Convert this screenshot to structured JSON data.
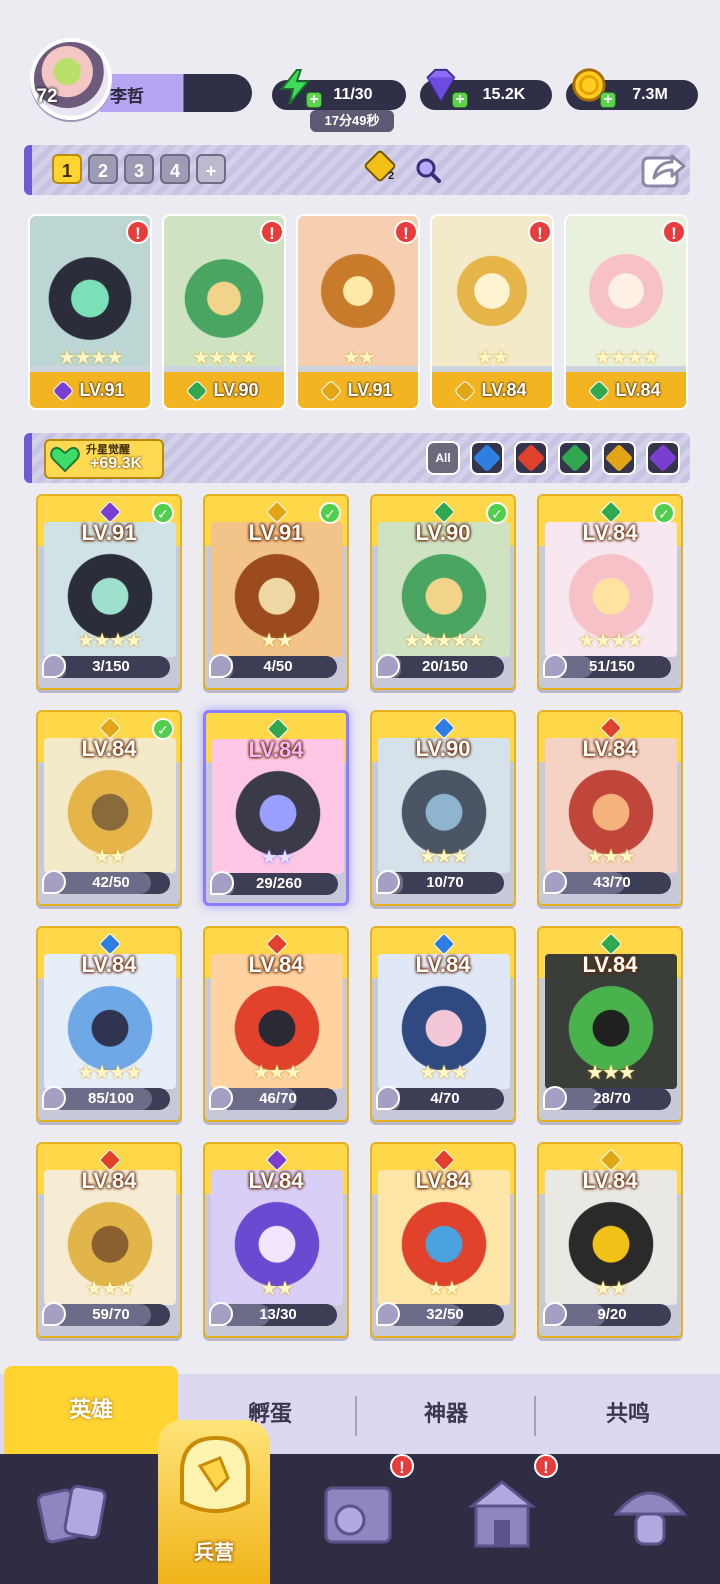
{
  "player": {
    "level": "72",
    "name": "李哲"
  },
  "resources": {
    "energy": "11/30",
    "energy_timer": "17分49秒",
    "gems": "15.2K",
    "gold": "7.3M"
  },
  "team_tabs": [
    "1",
    "2",
    "3",
    "4",
    "+"
  ],
  "team_key_count": "2",
  "team": [
    {
      "level": "LV.91",
      "element": "dark",
      "stars": "★★★★"
    },
    {
      "level": "LV.90",
      "element": "nature",
      "stars": "★★★★"
    },
    {
      "level": "LV.91",
      "element": "light",
      "stars": "★★"
    },
    {
      "level": "LV.84",
      "element": "light",
      "stars": "★★"
    },
    {
      "level": "LV.84",
      "element": "nature",
      "stars": "★★★★"
    }
  ],
  "awaken": {
    "label": "升星觉醒",
    "value": "+69.3K"
  },
  "filters": [
    "All",
    "water",
    "fire",
    "nature",
    "light",
    "dark"
  ],
  "heroes": [
    {
      "level": "LV.91",
      "element": "dark",
      "shards": "3/150",
      "progress": 0.02,
      "stars": "★★★★",
      "check": true
    },
    {
      "level": "LV.91",
      "element": "light",
      "shards": "4/50",
      "progress": 0.08,
      "stars": "★★",
      "check": true
    },
    {
      "level": "LV.90",
      "element": "nature",
      "shards": "20/150",
      "progress": 0.13,
      "stars": "★★★★★",
      "check": true
    },
    {
      "level": "LV.84",
      "element": "nature",
      "shards": "51/150",
      "progress": 0.34,
      "stars": "★★★★",
      "check": true
    },
    {
      "level": "LV.84",
      "element": "light",
      "shards": "42/50",
      "progress": 0.84,
      "stars": "★★",
      "check": true
    },
    {
      "level": "LV.84",
      "element": "nature",
      "shards": "29/260",
      "progress": 0.11,
      "stars": "★★",
      "check": false,
      "selected": true
    },
    {
      "level": "LV.90",
      "element": "water",
      "shards": "10/70",
      "progress": 0.14,
      "stars": "★★★",
      "check": false
    },
    {
      "level": "LV.84",
      "element": "fire",
      "shards": "43/70",
      "progress": 0.61,
      "stars": "★★★",
      "check": false
    },
    {
      "level": "LV.84",
      "element": "water",
      "shards": "85/100",
      "progress": 0.85,
      "stars": "★★★★",
      "check": false
    },
    {
      "level": "LV.84",
      "element": "fire",
      "shards": "46/70",
      "progress": 0.66,
      "stars": "★★★",
      "check": false
    },
    {
      "level": "LV.84",
      "element": "water",
      "shards": "4/70",
      "progress": 0.06,
      "stars": "★★★",
      "check": false
    },
    {
      "level": "LV.84",
      "element": "nature",
      "shards": "28/70",
      "progress": 0.4,
      "stars": "★★★",
      "check": false
    },
    {
      "level": "LV.84",
      "element": "fire",
      "shards": "59/70",
      "progress": 0.84,
      "stars": "★★★",
      "check": false
    },
    {
      "level": "LV.84",
      "element": "dark",
      "shards": "13/30",
      "progress": 0.43,
      "stars": "★★",
      "check": false
    },
    {
      "level": "LV.84",
      "element": "fire",
      "shards": "32/50",
      "progress": 0.64,
      "stars": "★★",
      "check": false
    },
    {
      "level": "LV.84",
      "element": "light",
      "shards": "9/20",
      "progress": 0.45,
      "stars": "★★",
      "check": false
    }
  ],
  "sub_tabs": [
    "英雄",
    "孵蛋",
    "神器",
    "共鸣"
  ],
  "nav": {
    "active_label": "兵营",
    "items": [
      "cards-icon",
      "barracks-icon",
      "map-icon",
      "shrine-icon",
      "mushroom-icon"
    ]
  },
  "colors": {
    "dark": "#7a3fd1",
    "nature": "#2fa84f",
    "light": "#e2a516",
    "water": "#2f7fe0",
    "fire": "#e0422b"
  }
}
